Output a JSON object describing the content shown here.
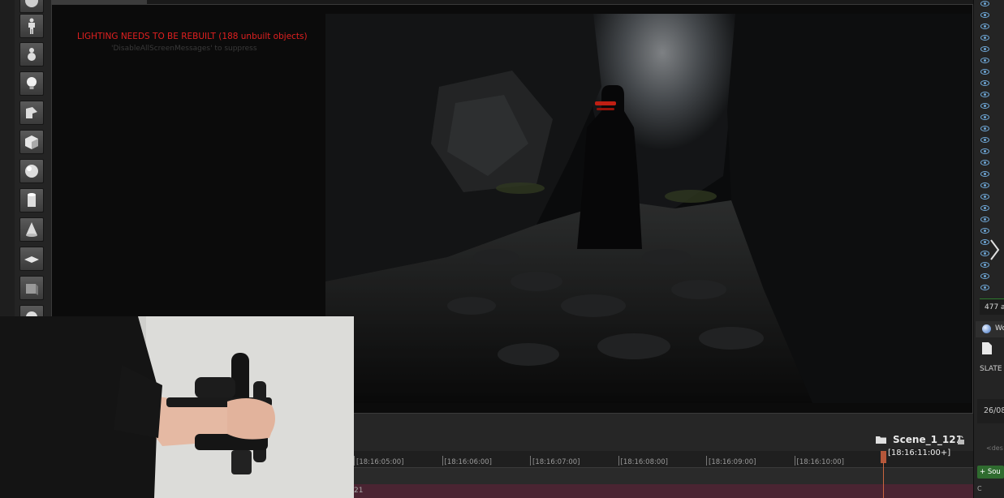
{
  "viewport": {
    "lighting_warning": "LIGHTING NEEDS TO BE REBUILT (188 unbuilt objects)",
    "screen_messages_hint": "'DisableAllScreenMessages' to suppress"
  },
  "toolbar": {
    "tools": [
      "actor-icon",
      "pawn-icon",
      "light-bulb-icon",
      "trigger-icon",
      "cube-icon",
      "sphere-icon",
      "cylinder-icon",
      "cone-icon",
      "plane-icon",
      "box-volume-icon",
      "sphere-small-icon"
    ]
  },
  "right_panel": {
    "count_text": "477 a",
    "world_tab_label": "Wo",
    "slate_label": "SLATE",
    "date_text": "26/08",
    "desc_placeholder": "<des",
    "source_button_label": "Sou",
    "footer_text": "C"
  },
  "sequencer": {
    "sequence_name": "Scene_1_121",
    "ticks": [
      "[18:16:05:00]",
      "[18:16:06:00]",
      "[18:16:07:00]",
      "[18:16:08:00]",
      "[18:16:09:00]",
      "[18:16:10:00]"
    ],
    "playhead_time": "[18:16:11:00+]",
    "track_text": "21"
  },
  "colors": {
    "warning_red": "#e02020",
    "playhead": "#c9653f",
    "track_bg": "#4a2432",
    "visor_glow": "#ff2a1a"
  }
}
